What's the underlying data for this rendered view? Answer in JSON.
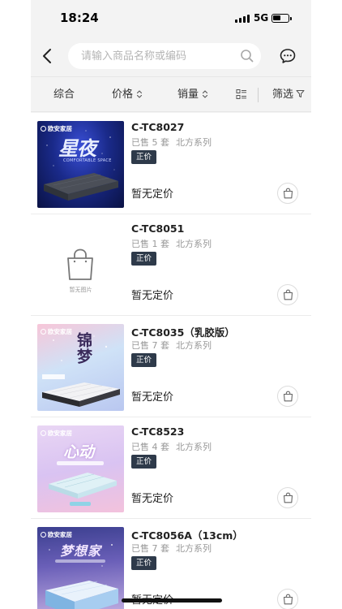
{
  "status_bar": {
    "time": "18:24",
    "network": "5G"
  },
  "search": {
    "placeholder": "请输入商品名称或编码",
    "value": ""
  },
  "filters": {
    "comprehensive": "综合",
    "price": "价格",
    "sales": "销量",
    "filter": "筛选"
  },
  "colors": {
    "tag_bg": "#2e3a4a",
    "page_bg": "#f3f3f3"
  },
  "products": [
    {
      "name": "C-TC8027",
      "sold": "已售 5 套",
      "series": "北方系列",
      "tag": "正价",
      "price": "暂无定价",
      "image": {
        "brand": "欧安家居",
        "title": "星夜",
        "subtitle": "COMFORTABLE SPACE"
      }
    },
    {
      "name": "C-TC8051",
      "sold": "已售 1 套",
      "series": "北方系列",
      "tag": "正价",
      "price": "暂无定价",
      "image": {
        "placeholder_text": "暂无图片"
      }
    },
    {
      "name": "C-TC8035（乳胶版）",
      "sold": "已售 7 套",
      "series": "北方系列",
      "tag": "正价",
      "price": "暂无定价",
      "image": {
        "brand": "欧安家居",
        "title": "锦梦"
      }
    },
    {
      "name": "C-TC8523",
      "sold": "已售 4 套",
      "series": "北方系列",
      "tag": "正价",
      "price": "暂无定价",
      "image": {
        "brand": "欧安家居",
        "title": "心动"
      }
    },
    {
      "name": "C-TC8056A（13cm）",
      "sold": "已售 7 套",
      "series": "北方系列",
      "tag": "正价",
      "price": "暂无定价",
      "image": {
        "brand": "欧安家居",
        "title": "梦想家"
      }
    }
  ]
}
